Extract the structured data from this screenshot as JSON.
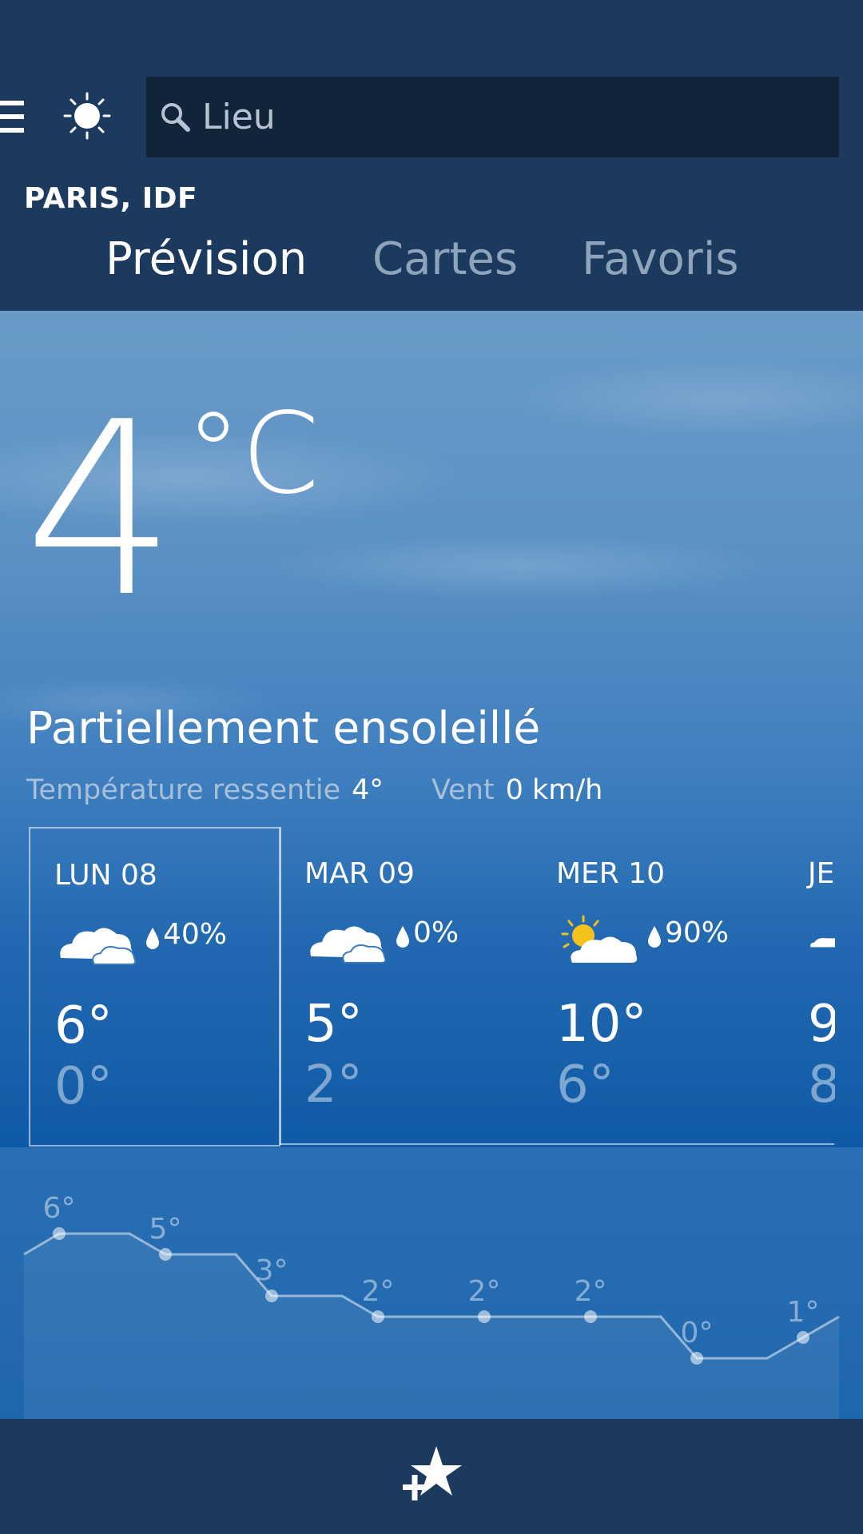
{
  "search": {
    "placeholder": "Lieu"
  },
  "location": "PARIS, IDF",
  "tabs": [
    {
      "label": "Prévision",
      "active": true
    },
    {
      "label": "Cartes",
      "active": false
    },
    {
      "label": "Favoris",
      "active": false
    }
  ],
  "current": {
    "temperature": "4",
    "unit": "°C",
    "condition": "Partiellement ensoleillé",
    "feels_like_label": "Température ressentie",
    "feels_like_value": "4°",
    "wind_label": "Vent",
    "wind_value": "0 km/h"
  },
  "days": [
    {
      "name": "LUN 08",
      "icon": "cloudy-icon",
      "rain": "40%",
      "high": "6°",
      "low": "0°",
      "selected": true
    },
    {
      "name": "MAR 09",
      "icon": "cloudy-icon",
      "rain": "0%",
      "high": "5°",
      "low": "2°",
      "selected": false
    },
    {
      "name": "MER 10",
      "icon": "partly-sunny-icon",
      "rain": "90%",
      "high": "10°",
      "low": "6°",
      "selected": false
    },
    {
      "name": "JE",
      "icon": "cloudy-icon",
      "rain": "",
      "high": "9",
      "low": "8",
      "selected": false
    }
  ],
  "hourly": {
    "labels": [
      "6°",
      "5°",
      "3°",
      "2°",
      "2°",
      "2°",
      "0°",
      "1°"
    ],
    "values": [
      6,
      5,
      3,
      2,
      2,
      2,
      0,
      1
    ]
  },
  "colors": {
    "header": "#1b3a5e",
    "search_bg": "#12243a",
    "sun": "#f5c21b"
  }
}
